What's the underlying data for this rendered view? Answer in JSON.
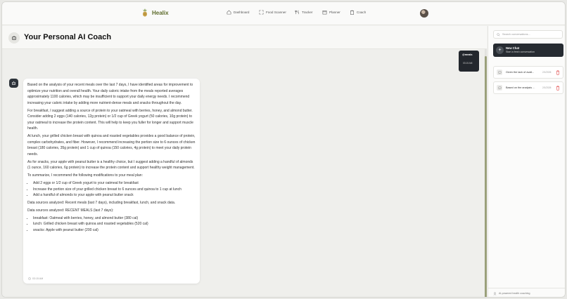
{
  "app": {
    "name": "Healix"
  },
  "nav": {
    "items": [
      {
        "label": "Dashboard",
        "icon": "home-icon"
      },
      {
        "label": "Food Scanner",
        "icon": "scanner-icon"
      },
      {
        "label": "Tracker",
        "icon": "utensils-icon"
      },
      {
        "label": "Planner",
        "icon": "calendar-icon"
      },
      {
        "label": "Coach",
        "icon": "clipboard-icon"
      }
    ]
  },
  "header": {
    "title": "Your Personal AI Coach"
  },
  "chat": {
    "user_message": {
      "text": "@meals",
      "time": "03:15 AM"
    },
    "bot_message": {
      "paragraphs": [
        "Based on the analysis of your recent meals over the last 7 days, I have identified areas for improvement to optimize your nutrition and overall health. Your daily caloric intake from the meals reported averages approximately 1100 calories, which may be insufficient to support your daily energy needs. I recommend increasing your caloric intake by adding more nutrient-dense meals and snacks throughout the day.",
        "For breakfast, I suggest adding a source of protein to your oatmeal with berries, honey, and almond butter. Consider adding 2 eggs (140 calories, 12g protein) or 1/2 cup of Greek yogurt (50 calories, 10g protein) to your oatmeal to increase the protein content. This will help to keep you fuller for longer and support muscle health.",
        "At lunch, your grilled chicken breast with quinoa and roasted vegetables provides a good balance of protein, complex carbohydrates, and fiber. However, I recommend increasing the portion size to 6 ounces of chicken breast (180 calories, 35g protein) and 1 cup of quinoa (150 calories, 4g protein) to meet your daily protein needs.",
        "As for snacks, your apple with peanut butter is a healthy choice, but I suggest adding a handful of almonds (1 ounce, 160 calories, 6g protein) to increase the protein content and support healthy weight management.",
        "To summarize, I recommend the following modifications to your meal plan:"
      ],
      "bullets": [
        "Add 2 eggs or 1/2 cup of Greek yogurt to your oatmeal for breakfast",
        "Increase the portion size of your grilled chicken breast to 6 ounces and quinoa to 1 cup at lunch",
        "Add a handful of almonds to your apple with peanut butter snack"
      ],
      "sources_1": "Data sources analyzed: Recent meals (last 7 days), including breakfast, lunch, and snack data.",
      "sources_2": "Data sources analyzed: RECENT MEALS (last 7 days):",
      "sources_bullets": [
        "breakfast: Oatmeal with berries, honey, and almond butter (380 cal)",
        "lunch: Grilled chicken breast with quinoa and roasted vegetables (520 cal)",
        "snacks: Apple with peanut butter (200 cal)"
      ],
      "time": "03:15 AM"
    }
  },
  "sidebar": {
    "search_placeholder": "Search conversations...",
    "new_chat": {
      "title": "New Chat",
      "subtitle": "Start a fresh conversation"
    },
    "conversations": [
      {
        "title": "Given the lack of avail...",
        "date": "2/1/2026"
      },
      {
        "title": "Based on the analysis ...",
        "date": "2/1/2026"
      }
    ],
    "footer": "AI-powered health coaching"
  },
  "colors": {
    "brand": "#5d6b2a",
    "dark": "#262b31",
    "delete": "#e04848"
  }
}
